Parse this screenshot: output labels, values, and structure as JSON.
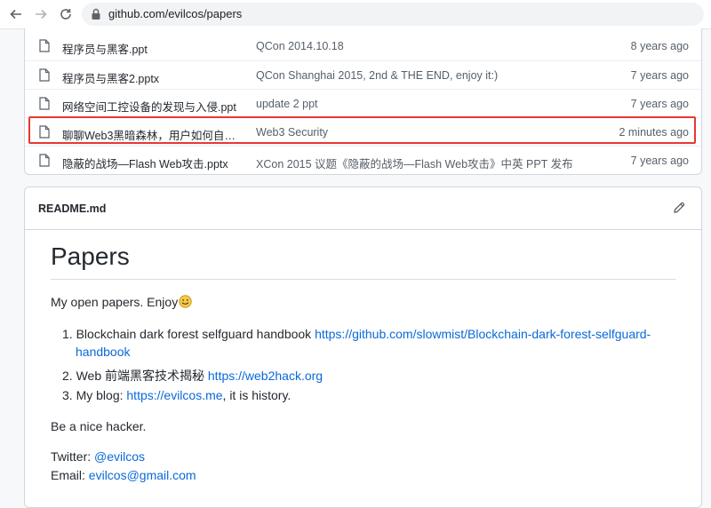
{
  "browser": {
    "url": "github.com/evilcos/papers"
  },
  "files": [
    {
      "name": "程序员与黑客.ppt",
      "message": "QCon 2014.10.18",
      "age": "8 years ago"
    },
    {
      "name": "程序员与黑客2.pptx",
      "message": "QCon Shanghai 2015, 2nd & THE END, enjoy it:)",
      "age": "7 years ago"
    },
    {
      "name": "网络空间工控设备的发现与入侵.ppt",
      "message": "update 2 ppt",
      "age": "7 years ago"
    },
    {
      "name": "聊聊Web3黑暗森林，用户如何自我...",
      "message": "Web3 Security",
      "age": "2 minutes ago"
    },
    {
      "name": "隐蔽的战场—Flash Web攻击.pptx",
      "message": "XCon 2015 议题《隐蔽的战场—Flash Web攻击》中英 PPT 发布",
      "age": "7 years ago"
    }
  ],
  "readme": {
    "filename": "README.md",
    "heading": "Papers",
    "intro": "My open papers. Enjoy",
    "items": [
      {
        "num": "1.",
        "text": "Blockchain dark forest selfguard handbook ",
        "link": "https://github.com/slowmist/Blockchain-dark-forest-selfguard-",
        "link_cont": "handbook"
      },
      {
        "num": "2.",
        "text": "Web 前端黑客技术揭秘 ",
        "link": "https://web2hack.org"
      },
      {
        "num": "3.",
        "text": "My blog: ",
        "link": "https://evilcos.me",
        "suffix": ", it is history."
      }
    ],
    "closing": "Be a nice hacker.",
    "twitter_label": "Twitter: ",
    "twitter_handle": "@evilcos",
    "email_label": "Email: ",
    "email": "evilcos@gmail.com"
  },
  "colors": {
    "link": "#0969da",
    "highlight": "#e53935"
  }
}
